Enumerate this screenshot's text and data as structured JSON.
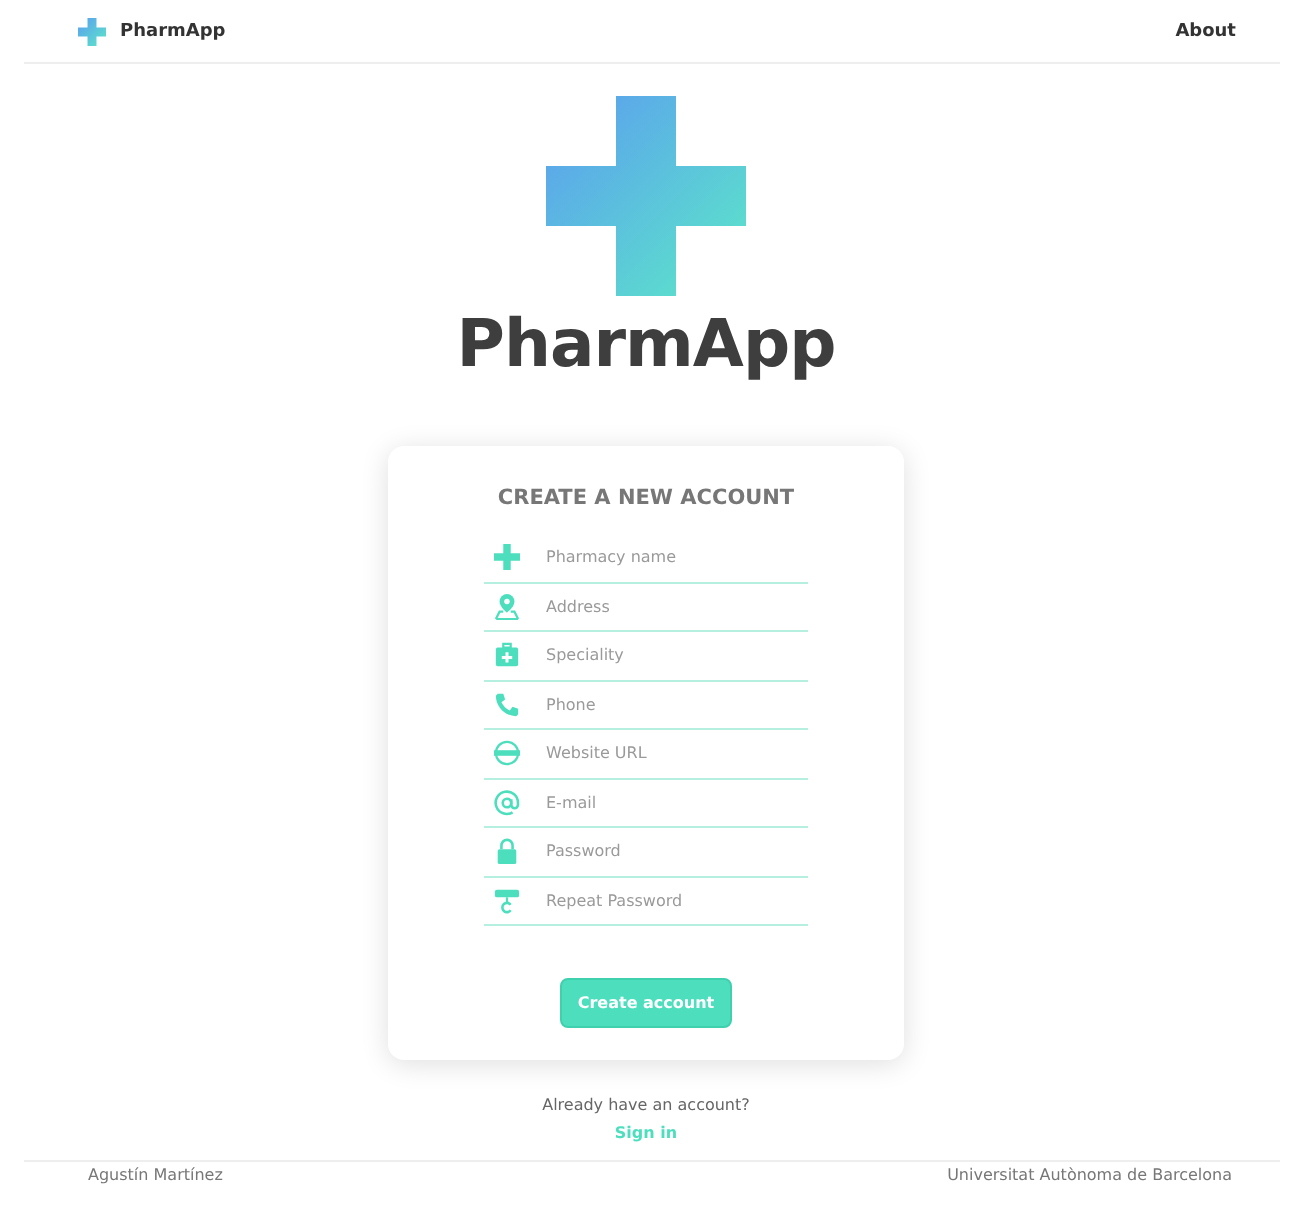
{
  "navbar": {
    "brand": "PharmApp",
    "link": "About"
  },
  "hero": {
    "title": "PharmApp"
  },
  "form": {
    "title": "CREATE A NEW ACCOUNT",
    "fields": [
      {
        "kind": "cross",
        "placeholder": "Pharmacy name"
      },
      {
        "kind": "pin",
        "placeholder": "Address"
      },
      {
        "kind": "kit",
        "placeholder": "Speciality"
      },
      {
        "kind": "phone",
        "placeholder": "Phone"
      },
      {
        "kind": "web",
        "placeholder": "Website URL"
      },
      {
        "kind": "at",
        "placeholder": "E-mail"
      },
      {
        "kind": "lock",
        "placeholder": "Password"
      },
      {
        "kind": "key",
        "placeholder": "Repeat Password"
      }
    ],
    "button": "Create account"
  },
  "signin": {
    "prompt": "Already have an account?",
    "link": "Sign in"
  },
  "footer": {
    "left": "Agustín Martínez",
    "right": "Universitat Autònoma de Barcelona"
  }
}
